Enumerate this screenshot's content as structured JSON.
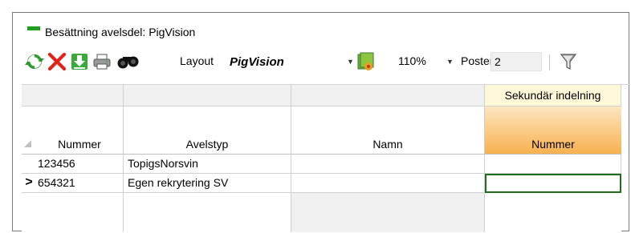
{
  "window": {
    "title": "Besättning avelsdel: PigVision",
    "title_mark_color": "#1ea01e"
  },
  "toolbar": {
    "refresh_icon": "refresh-icon",
    "delete_icon": "delete-icon",
    "download_icon": "download-icon",
    "print_icon": "print-icon",
    "find_icon": "binoculars-icon",
    "layout_label": "Layout",
    "layout_value": "PigVision",
    "layout_settings_icon": "layout-settings-icon",
    "zoom_value": "110%",
    "poster_label": "Poster",
    "poster_value": "2",
    "filter_icon": "filter-icon"
  },
  "grid": {
    "group_header": "Sekundär indelning",
    "columns": [
      "Nummer",
      "Avelstyp",
      "Namn",
      "Nummer"
    ],
    "rows": [
      {
        "indicator": "",
        "cells": [
          "123456",
          "TopigsNorsvin",
          "",
          ""
        ]
      },
      {
        "indicator": ">",
        "cells": [
          "654321",
          "Egen rekrytering SV",
          "",
          ""
        ]
      }
    ],
    "selected_cell_color": "#1e6e1e",
    "secondary_header_color": "#f7b14f"
  }
}
